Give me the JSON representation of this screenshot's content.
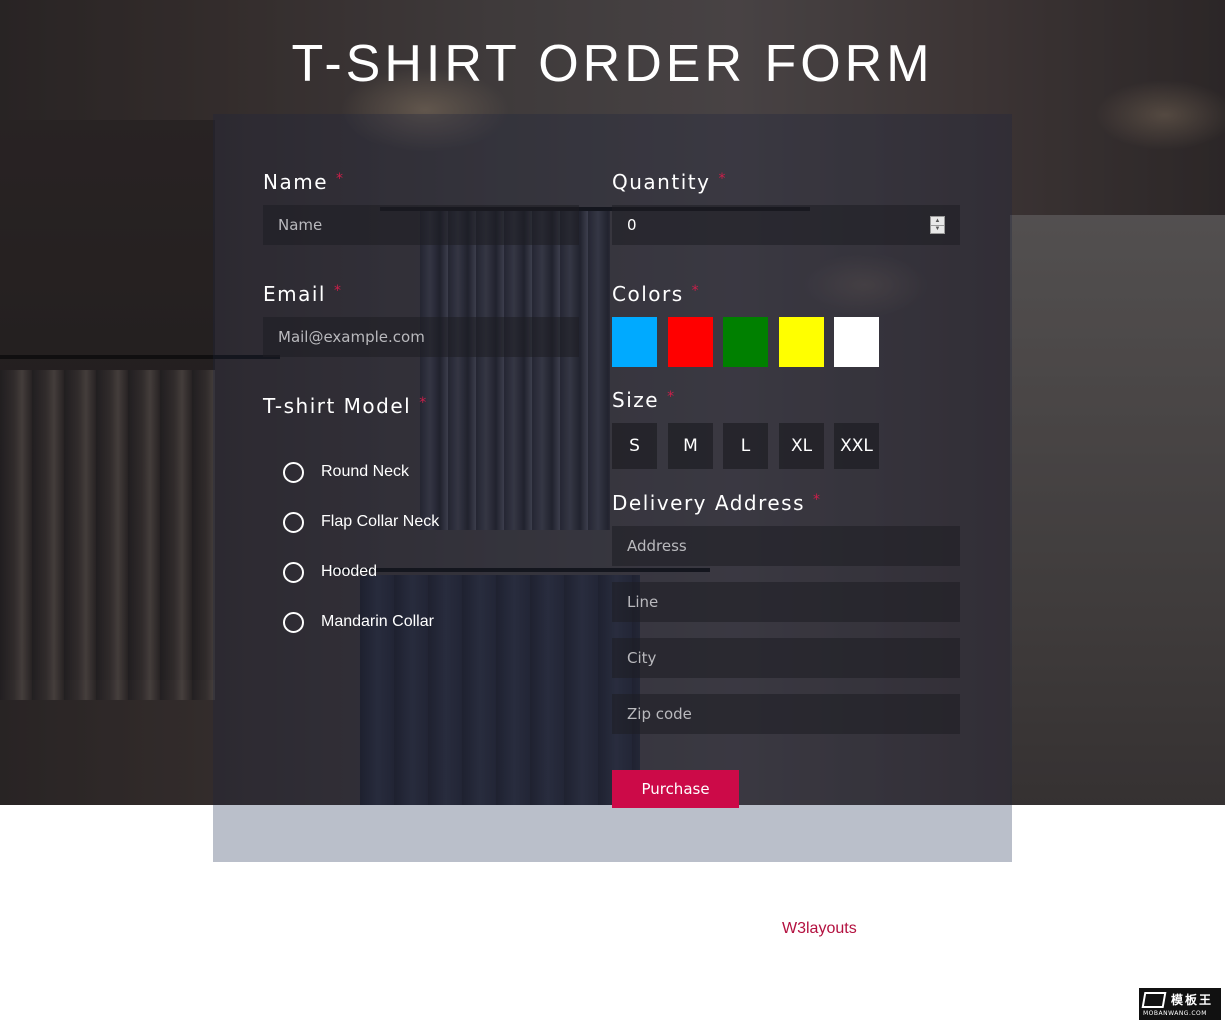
{
  "page": {
    "title": "T-SHIRT ORDER FORM"
  },
  "form": {
    "name": {
      "label": "Name",
      "required_mark": "*",
      "placeholder": "Name"
    },
    "email": {
      "label": "Email",
      "required_mark": "*",
      "placeholder": "Mail@example.com"
    },
    "model": {
      "label": "T-shirt Model",
      "required_mark": "*",
      "options": [
        "Round Neck",
        "Flap Collar Neck",
        "Hooded",
        "Mandarin Collar"
      ]
    },
    "quantity": {
      "label": "Quantity",
      "required_mark": "*",
      "value": "0"
    },
    "colors": {
      "label": "Colors",
      "required_mark": "*",
      "swatches": [
        {
          "name": "blue",
          "hex": "#00aaff"
        },
        {
          "name": "red",
          "hex": "#ff0000"
        },
        {
          "name": "green",
          "hex": "#008000"
        },
        {
          "name": "yellow",
          "hex": "#ffff00"
        },
        {
          "name": "white",
          "hex": "#ffffff"
        }
      ]
    },
    "size": {
      "label": "Size",
      "required_mark": "*",
      "options": [
        "S",
        "M",
        "L",
        "XL",
        "XXL"
      ]
    },
    "address": {
      "label": "Delivery Address",
      "required_mark": "*",
      "placeholders": {
        "address": "Address",
        "line": "Line",
        "city": "City",
        "zip": "Zip code"
      }
    },
    "submit_label": "Purchase"
  },
  "footer": {
    "credit_link": "W3layouts"
  },
  "watermark": {
    "main": "模板王",
    "sub": "MOBANWANG.COM"
  },
  "colors": {
    "accent": "#cc0a48",
    "required": "#cc1f4a"
  }
}
